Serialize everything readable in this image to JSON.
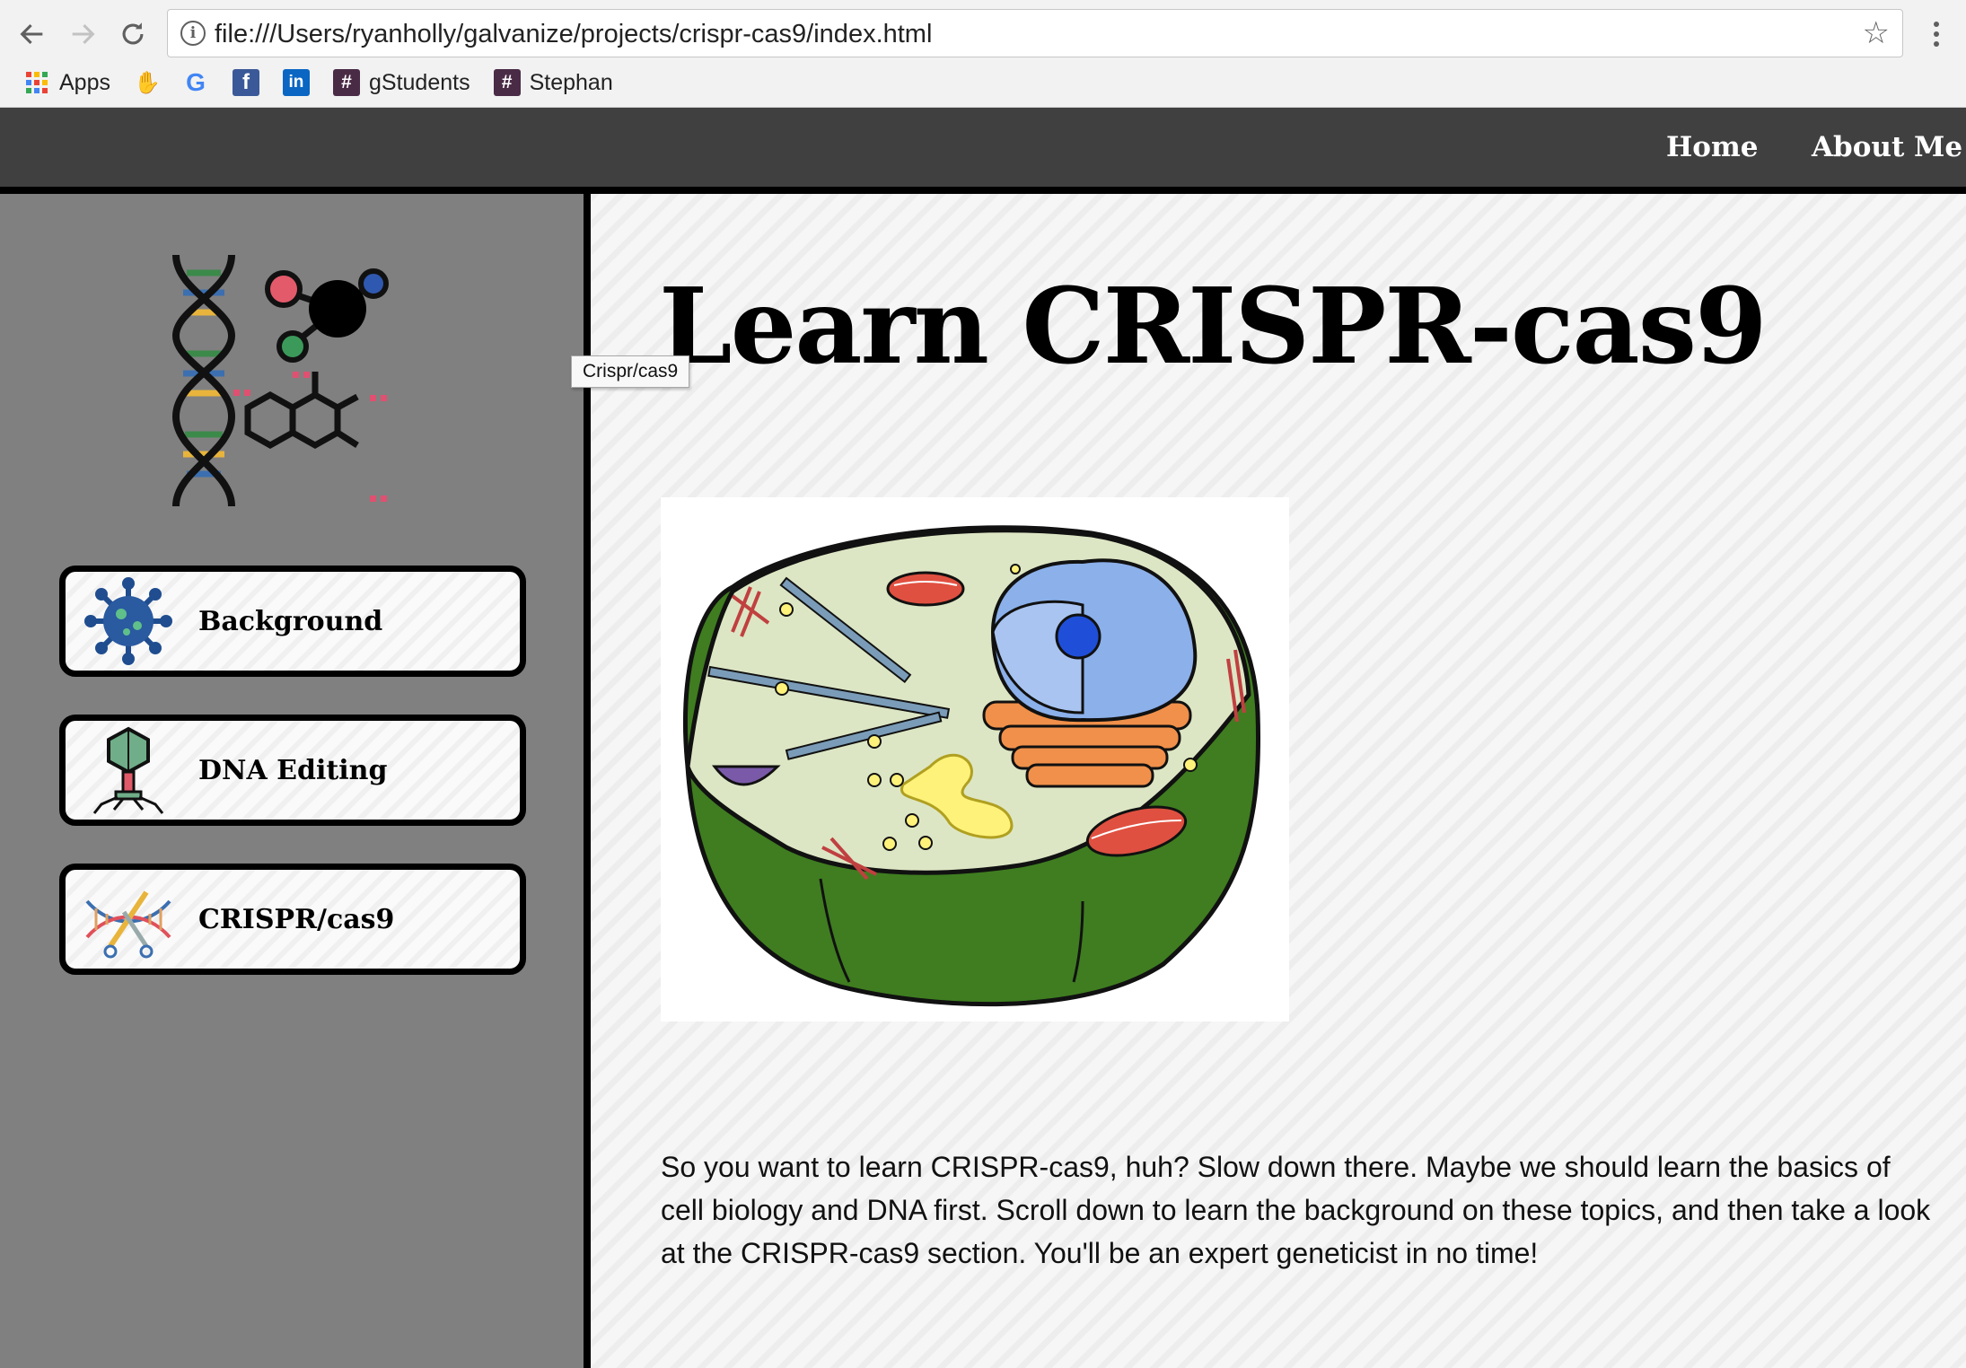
{
  "browser": {
    "url": "file:///Users/ryanholly/galvanize/projects/crispr-cas9/index.html",
    "bookmarks": [
      {
        "label": "Apps",
        "icon": "apps-grid-icon"
      },
      {
        "label": "",
        "icon": "bookmark-hand-icon"
      },
      {
        "label": "",
        "icon": "google-icon",
        "glyph": "G"
      },
      {
        "label": "",
        "icon": "facebook-icon",
        "glyph": "f"
      },
      {
        "label": "",
        "icon": "linkedin-icon",
        "glyph": "in"
      },
      {
        "label": "gStudents",
        "icon": "slack-hash-icon",
        "glyph": "#"
      },
      {
        "label": "Stephan",
        "icon": "slack-hash-icon",
        "glyph": "#"
      }
    ]
  },
  "header": {
    "nav": [
      {
        "label": "Home"
      },
      {
        "label": "About Me"
      }
    ]
  },
  "sidebar": {
    "logo": "dna-molecule-logo",
    "items": [
      {
        "label": "Background",
        "icon": "virus-icon"
      },
      {
        "label": "DNA Editing",
        "icon": "bacteriophage-icon"
      },
      {
        "label": "CRISPR/cas9",
        "icon": "dna-scissors-icon"
      }
    ]
  },
  "main": {
    "title": "Learn CRISPR-cas9",
    "tooltip": "Crispr/cas9",
    "image": "animal-cell-diagram",
    "intro": "So you want to learn CRISPR-cas9, huh? Slow down there. Maybe we should learn the basics of cell biology and DNA first. Scroll down to learn the background on these topics, and then take a look at the CRISPR-cas9 section. You'll be an expert geneticist in no time!"
  },
  "colors": {
    "header_bg": "#404040",
    "sidebar_bg": "#808080",
    "main_bg": "#f6f6f6",
    "cell_membrane_green": "#3f7d20",
    "cell_cytoplasm": "#dde6c4",
    "nucleus_blue": "#7aa0e0"
  }
}
